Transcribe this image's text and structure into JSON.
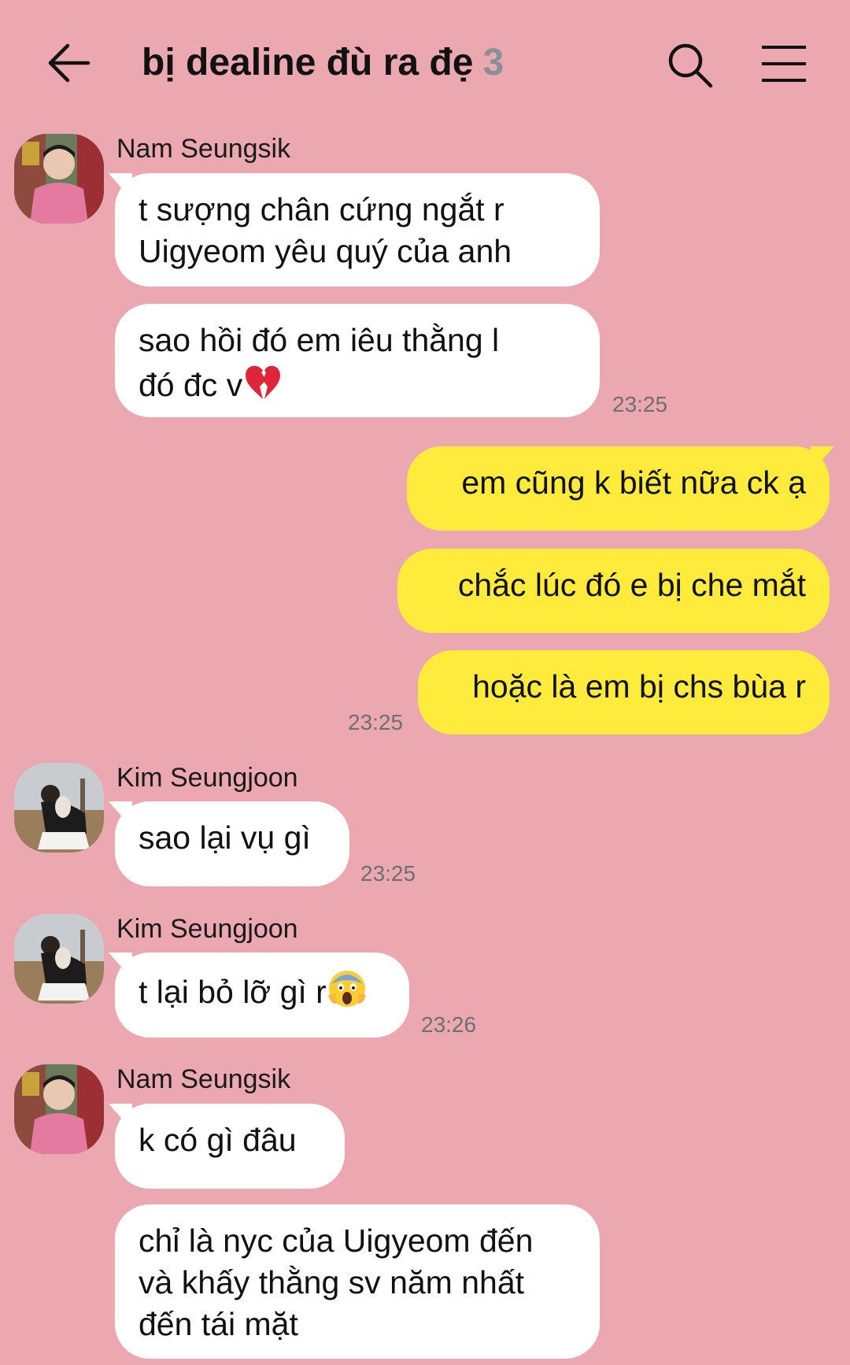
{
  "header": {
    "title": "bị dealine đù ra đẹ",
    "member_count": "3",
    "back_icon": "arrow-left-icon",
    "search_icon": "search-icon",
    "menu_icon": "hamburger-menu-icon"
  },
  "colors": {
    "background": "#eba8b0",
    "incoming_bubble": "#ffffff",
    "outgoing_bubble": "#ffeb3b",
    "timestamp": "#6f6f6f",
    "member_count": "#8a8f97"
  },
  "messages": [
    {
      "sender": "Nam Seungsik",
      "bubbles": [
        {
          "lines": [
            "t sượng chân cứng ngắt r",
            "Uigyeom yêu quý của anh"
          ]
        },
        {
          "lines": [
            "sao hồi đó em iêu thằng l",
            "đó đc v"
          ],
          "emoji": "💔",
          "emoji_name": "broken-heart-emoji"
        }
      ],
      "time": "23:25"
    },
    {
      "sender": "me",
      "bubbles": [
        {
          "lines": [
            "em cũng k biết nữa ck ạ"
          ]
        },
        {
          "lines": [
            "chắc lúc đó e bị che mắt"
          ]
        },
        {
          "lines": [
            "hoặc là em bị chs bùa r"
          ]
        }
      ],
      "time": "23:25"
    },
    {
      "sender": "Kim Seungjoon",
      "bubbles": [
        {
          "lines": [
            "sao lại vụ gì"
          ]
        }
      ],
      "time": "23:25"
    },
    {
      "sender": "Kim Seungjoon",
      "bubbles": [
        {
          "lines": [
            "t lại bỏ lỡ gì r"
          ],
          "emoji": "😱",
          "emoji_name": "screaming-face-emoji"
        }
      ],
      "time": "23:26"
    },
    {
      "sender": "Nam Seungsik",
      "bubbles": [
        {
          "lines": [
            "k có gì đâu"
          ]
        },
        {
          "lines": [
            "chỉ là nyc của Uigyeom đến",
            "và khấy thằng sv năm nhất",
            "đến tái mặt"
          ]
        }
      ]
    }
  ]
}
